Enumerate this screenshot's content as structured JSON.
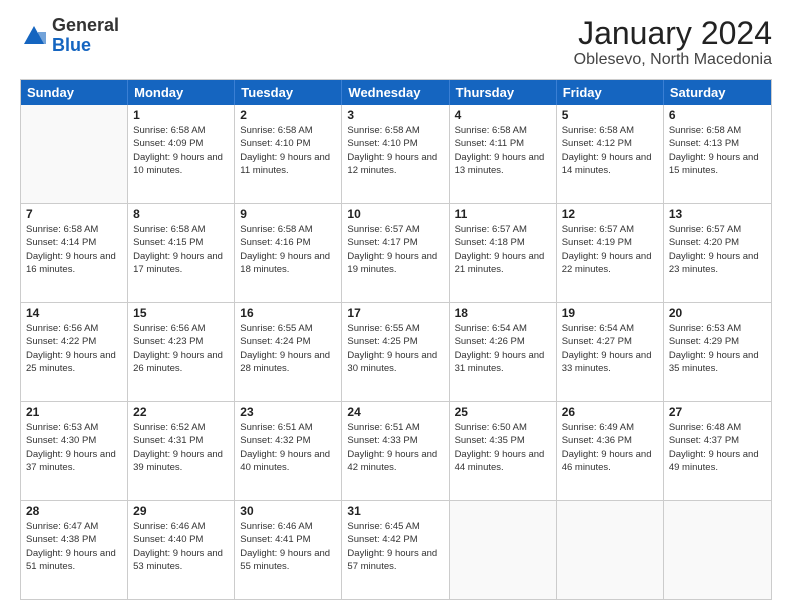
{
  "header": {
    "logo_general": "General",
    "logo_blue": "Blue",
    "title": "January 2024",
    "location": "Oblesevo, North Macedonia"
  },
  "days_of_week": [
    "Sunday",
    "Monday",
    "Tuesday",
    "Wednesday",
    "Thursday",
    "Friday",
    "Saturday"
  ],
  "weeks": [
    [
      {
        "day": "",
        "sunrise": "",
        "sunset": "",
        "daylight": "",
        "empty": true
      },
      {
        "day": "1",
        "sunrise": "Sunrise: 6:58 AM",
        "sunset": "Sunset: 4:09 PM",
        "daylight": "Daylight: 9 hours and 10 minutes."
      },
      {
        "day": "2",
        "sunrise": "Sunrise: 6:58 AM",
        "sunset": "Sunset: 4:10 PM",
        "daylight": "Daylight: 9 hours and 11 minutes."
      },
      {
        "day": "3",
        "sunrise": "Sunrise: 6:58 AM",
        "sunset": "Sunset: 4:10 PM",
        "daylight": "Daylight: 9 hours and 12 minutes."
      },
      {
        "day": "4",
        "sunrise": "Sunrise: 6:58 AM",
        "sunset": "Sunset: 4:11 PM",
        "daylight": "Daylight: 9 hours and 13 minutes."
      },
      {
        "day": "5",
        "sunrise": "Sunrise: 6:58 AM",
        "sunset": "Sunset: 4:12 PM",
        "daylight": "Daylight: 9 hours and 14 minutes."
      },
      {
        "day": "6",
        "sunrise": "Sunrise: 6:58 AM",
        "sunset": "Sunset: 4:13 PM",
        "daylight": "Daylight: 9 hours and 15 minutes."
      }
    ],
    [
      {
        "day": "7",
        "sunrise": "Sunrise: 6:58 AM",
        "sunset": "Sunset: 4:14 PM",
        "daylight": "Daylight: 9 hours and 16 minutes."
      },
      {
        "day": "8",
        "sunrise": "Sunrise: 6:58 AM",
        "sunset": "Sunset: 4:15 PM",
        "daylight": "Daylight: 9 hours and 17 minutes."
      },
      {
        "day": "9",
        "sunrise": "Sunrise: 6:58 AM",
        "sunset": "Sunset: 4:16 PM",
        "daylight": "Daylight: 9 hours and 18 minutes."
      },
      {
        "day": "10",
        "sunrise": "Sunrise: 6:57 AM",
        "sunset": "Sunset: 4:17 PM",
        "daylight": "Daylight: 9 hours and 19 minutes."
      },
      {
        "day": "11",
        "sunrise": "Sunrise: 6:57 AM",
        "sunset": "Sunset: 4:18 PM",
        "daylight": "Daylight: 9 hours and 21 minutes."
      },
      {
        "day": "12",
        "sunrise": "Sunrise: 6:57 AM",
        "sunset": "Sunset: 4:19 PM",
        "daylight": "Daylight: 9 hours and 22 minutes."
      },
      {
        "day": "13",
        "sunrise": "Sunrise: 6:57 AM",
        "sunset": "Sunset: 4:20 PM",
        "daylight": "Daylight: 9 hours and 23 minutes."
      }
    ],
    [
      {
        "day": "14",
        "sunrise": "Sunrise: 6:56 AM",
        "sunset": "Sunset: 4:22 PM",
        "daylight": "Daylight: 9 hours and 25 minutes."
      },
      {
        "day": "15",
        "sunrise": "Sunrise: 6:56 AM",
        "sunset": "Sunset: 4:23 PM",
        "daylight": "Daylight: 9 hours and 26 minutes."
      },
      {
        "day": "16",
        "sunrise": "Sunrise: 6:55 AM",
        "sunset": "Sunset: 4:24 PM",
        "daylight": "Daylight: 9 hours and 28 minutes."
      },
      {
        "day": "17",
        "sunrise": "Sunrise: 6:55 AM",
        "sunset": "Sunset: 4:25 PM",
        "daylight": "Daylight: 9 hours and 30 minutes."
      },
      {
        "day": "18",
        "sunrise": "Sunrise: 6:54 AM",
        "sunset": "Sunset: 4:26 PM",
        "daylight": "Daylight: 9 hours and 31 minutes."
      },
      {
        "day": "19",
        "sunrise": "Sunrise: 6:54 AM",
        "sunset": "Sunset: 4:27 PM",
        "daylight": "Daylight: 9 hours and 33 minutes."
      },
      {
        "day": "20",
        "sunrise": "Sunrise: 6:53 AM",
        "sunset": "Sunset: 4:29 PM",
        "daylight": "Daylight: 9 hours and 35 minutes."
      }
    ],
    [
      {
        "day": "21",
        "sunrise": "Sunrise: 6:53 AM",
        "sunset": "Sunset: 4:30 PM",
        "daylight": "Daylight: 9 hours and 37 minutes."
      },
      {
        "day": "22",
        "sunrise": "Sunrise: 6:52 AM",
        "sunset": "Sunset: 4:31 PM",
        "daylight": "Daylight: 9 hours and 39 minutes."
      },
      {
        "day": "23",
        "sunrise": "Sunrise: 6:51 AM",
        "sunset": "Sunset: 4:32 PM",
        "daylight": "Daylight: 9 hours and 40 minutes."
      },
      {
        "day": "24",
        "sunrise": "Sunrise: 6:51 AM",
        "sunset": "Sunset: 4:33 PM",
        "daylight": "Daylight: 9 hours and 42 minutes."
      },
      {
        "day": "25",
        "sunrise": "Sunrise: 6:50 AM",
        "sunset": "Sunset: 4:35 PM",
        "daylight": "Daylight: 9 hours and 44 minutes."
      },
      {
        "day": "26",
        "sunrise": "Sunrise: 6:49 AM",
        "sunset": "Sunset: 4:36 PM",
        "daylight": "Daylight: 9 hours and 46 minutes."
      },
      {
        "day": "27",
        "sunrise": "Sunrise: 6:48 AM",
        "sunset": "Sunset: 4:37 PM",
        "daylight": "Daylight: 9 hours and 49 minutes."
      }
    ],
    [
      {
        "day": "28",
        "sunrise": "Sunrise: 6:47 AM",
        "sunset": "Sunset: 4:38 PM",
        "daylight": "Daylight: 9 hours and 51 minutes."
      },
      {
        "day": "29",
        "sunrise": "Sunrise: 6:46 AM",
        "sunset": "Sunset: 4:40 PM",
        "daylight": "Daylight: 9 hours and 53 minutes."
      },
      {
        "day": "30",
        "sunrise": "Sunrise: 6:46 AM",
        "sunset": "Sunset: 4:41 PM",
        "daylight": "Daylight: 9 hours and 55 minutes."
      },
      {
        "day": "31",
        "sunrise": "Sunrise: 6:45 AM",
        "sunset": "Sunset: 4:42 PM",
        "daylight": "Daylight: 9 hours and 57 minutes."
      },
      {
        "day": "",
        "sunrise": "",
        "sunset": "",
        "daylight": "",
        "empty": true
      },
      {
        "day": "",
        "sunrise": "",
        "sunset": "",
        "daylight": "",
        "empty": true
      },
      {
        "day": "",
        "sunrise": "",
        "sunset": "",
        "daylight": "",
        "empty": true
      }
    ]
  ]
}
